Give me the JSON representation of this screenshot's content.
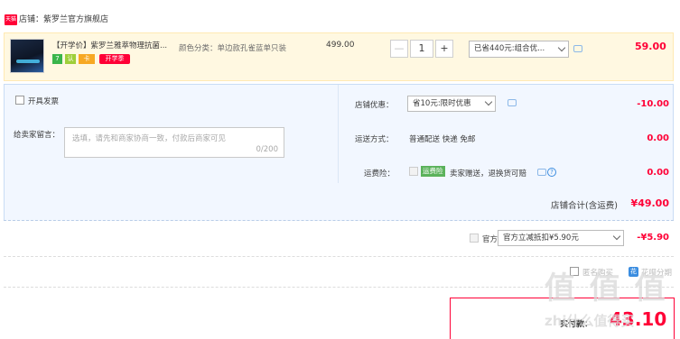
{
  "shop": {
    "tag": "天猫",
    "name": "店铺：紫罗兰官方旗舰店"
  },
  "item": {
    "title": "【开学价】紫罗兰雅萃物理抗菌...",
    "badges": [
      "7",
      "认",
      "卡"
    ],
    "promo_badge": "开学季",
    "sku": "颜色分类：单边款孔雀蓝单只装",
    "unit_price": "499.00",
    "quantity": "1",
    "minus": "—",
    "plus": "+",
    "discount": "已省440元:组合优...",
    "total": "59.00"
  },
  "invoice": {
    "label": "开具发票"
  },
  "message": {
    "label": "给卖家留言：",
    "placeholder": "选填，请先和商家协商一致，付款后商家可见",
    "counter": "0/200"
  },
  "shop_discount": {
    "label": "店铺优惠：",
    "selected": "省10元:限时优惠",
    "value": "-10.00"
  },
  "delivery": {
    "label": "运送方式：",
    "method": "普通配送 快递 免邮",
    "value": "0.00"
  },
  "freight_insurance": {
    "label": "运费险：",
    "tag": "运费险",
    "desc": "卖家赠送，退换货可赔",
    "value": "0.00"
  },
  "subtotal": {
    "label": "店铺合计(含运费)",
    "value": "¥49.00"
  },
  "platform": {
    "label": "官方立减",
    "selected": "官方立减抵扣¥5.90元",
    "value": "-¥5.90"
  },
  "options": {
    "anon": "匿名购买",
    "alipay": "花呗分期"
  },
  "pay": {
    "label": "实付款：",
    "value": "43.10"
  },
  "watermark": {
    "main": "值 值 值",
    "site": "zhi什么值得买"
  },
  "colors": {
    "accent": "#ff0036",
    "item_bg": "#fff8e1",
    "info_bg": "#f2f7ff"
  }
}
